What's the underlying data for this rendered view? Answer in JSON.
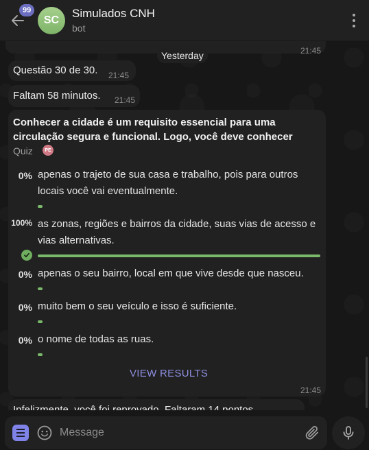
{
  "header": {
    "unread_count": "99",
    "avatar_initials": "SC",
    "title": "Simulados CNH",
    "subtitle": "bot"
  },
  "messages": {
    "top_time": "21:45",
    "date_separator": "Yesterday",
    "msg1": {
      "text": "Questão 30 de 30.",
      "time": "21:45"
    },
    "msg2": {
      "text": "Faltam 58 minutos.",
      "time": "21:45"
    },
    "poll": {
      "question": "Conhecer a cidade é um requisito essencial para uma circulação segura e funcional. Logo, você deve conhecer",
      "type_label": "Quiz",
      "voter_initials": "PE",
      "options": [
        {
          "percent": "0%",
          "text": "apenas o trajeto de sua casa e trabalho, pois para outros locais você vai eventualmente.",
          "fill": 0.0,
          "correct": false
        },
        {
          "percent": "100%",
          "text": "as zonas, regiões e bairros da cidade, suas vias de acesso e vias alternativas.",
          "fill": 1.0,
          "correct": true
        },
        {
          "percent": "0%",
          "text": "apenas o seu bairro, local em que vive desde que nasceu.",
          "fill": 0.0,
          "correct": false
        },
        {
          "percent": "0%",
          "text": "muito bem o seu veículo e isso é suficiente.",
          "fill": 0.0,
          "correct": false
        },
        {
          "percent": "0%",
          "text": "o nome de todas as ruas.",
          "fill": 0.0,
          "correct": false
        }
      ],
      "view_results_label": "VIEW RESULTS",
      "time": "21:45"
    },
    "partial_msg": "Infelizmente, você foi reprovado. Faltaram 14 pontos"
  },
  "composer": {
    "placeholder": "Message"
  },
  "colors": {
    "accent": "#7f82e6",
    "poll_bar": "#7ab96b",
    "bubble": "#212121"
  },
  "icons": [
    "back-arrow-icon",
    "more-vertical-icon",
    "check-icon",
    "menu-icon",
    "emoji-icon",
    "paperclip-icon",
    "microphone-icon"
  ]
}
